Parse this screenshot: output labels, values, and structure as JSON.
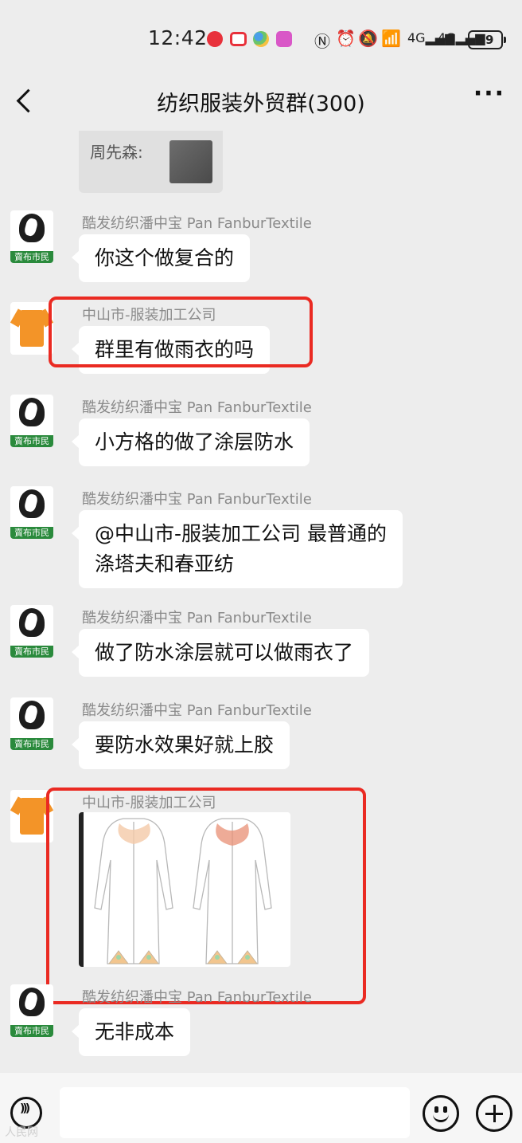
{
  "status_bar": {
    "time": "12:42",
    "battery": "49"
  },
  "header": {
    "title": "纺织服装外贸群(300)",
    "more": "···"
  },
  "quoted": {
    "text": "周先森:"
  },
  "messages": [
    {
      "sender": "酷发纺织潘中宝 Pan FanburTextile",
      "text": "你这个做复合的",
      "avatar": "buyer-avatar"
    },
    {
      "sender": "中山市-服装加工公司",
      "text": "群里有做雨衣的吗",
      "avatar": "shirt-avatar"
    },
    {
      "sender": "酷发纺织潘中宝 Pan FanburTextile",
      "text": "小方格的做了涂层防水",
      "avatar": "buyer-avatar"
    },
    {
      "sender": "酷发纺织潘中宝 Pan FanburTextile",
      "line1": "@中山市-服装加工公司  最普通的",
      "line2": "涤塔夫和春亚纺",
      "avatar": "buyer-avatar"
    },
    {
      "sender": "酷发纺织潘中宝 Pan FanburTextile",
      "text": "做了防水涂层就可以做雨衣了",
      "avatar": "buyer-avatar"
    },
    {
      "sender": "酷发纺织潘中宝 Pan FanburTextile",
      "text": "要防水效果好就上胶",
      "avatar": "buyer-avatar"
    },
    {
      "sender": "中山市-服装加工公司",
      "image": "raincoat-sketch",
      "avatar": "shirt-avatar"
    },
    {
      "sender": "酷发纺织潘中宝 Pan FanburTextile",
      "text": "无非成本",
      "avatar": "buyer-avatar"
    }
  ],
  "avatar_tag": "賣布市民",
  "watermark": "人民网"
}
